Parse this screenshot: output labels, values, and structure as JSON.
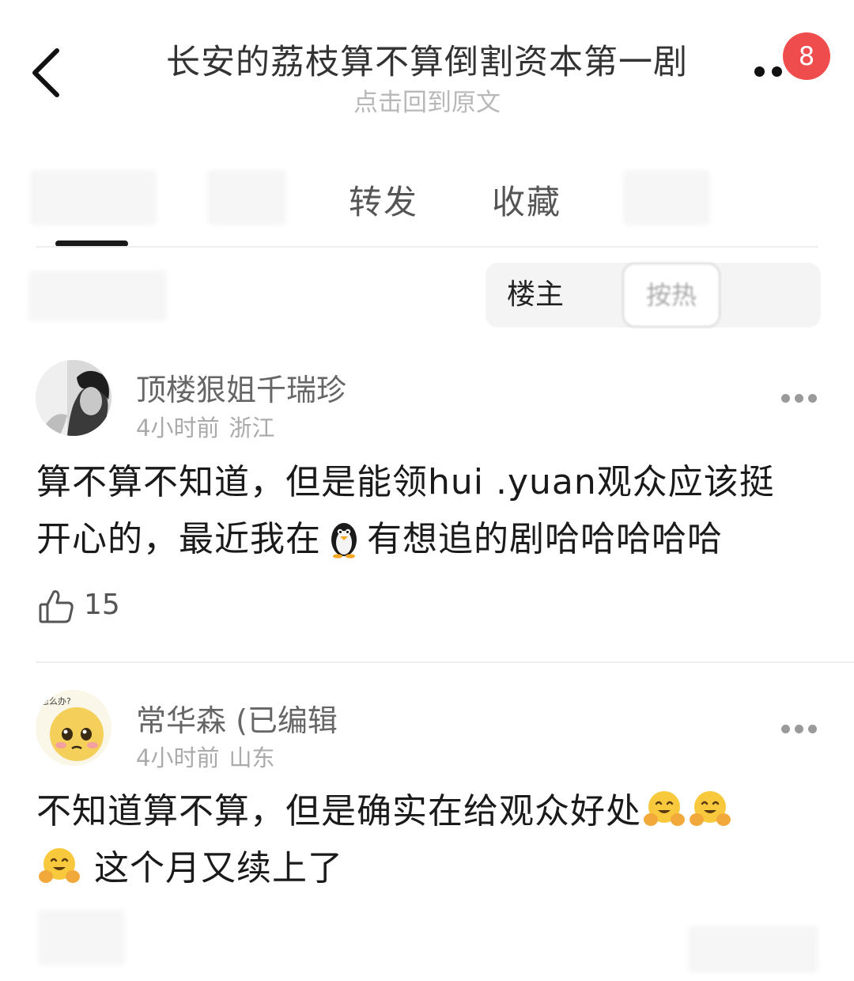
{
  "header": {
    "title": "长安的荔枝算不算倒割资本第一剧",
    "subtitle": "点击回到原文",
    "badge_count": "8"
  },
  "tabs": [
    {
      "label": "转发"
    },
    {
      "label": "收藏"
    }
  ],
  "filter": {
    "op_label": "楼主",
    "sort_label": "按热"
  },
  "comments": [
    {
      "username": "顶楼狠姐千瑞珍",
      "time": "4小时前",
      "location": "浙江",
      "text_line1": "算不算不知道，但是能领hui .yuan观众应该挺",
      "text_line2_before": "开心的，最近我在",
      "text_line2_emoji": "penguin-emoji",
      "text_line2_after": "有想追的剧哈哈哈哈哈",
      "likes": "15"
    },
    {
      "username": "常华森 (已编辑",
      "avatar_text": "怎么办?",
      "time": "4小时前",
      "location": "山东",
      "text_line1": "不知道算不算，但是确实在给观众好处",
      "text_line2": "这个月又续上了",
      "emoji": "hugging-face-emoji"
    }
  ],
  "colors": {
    "badge": "#ef4d4d",
    "text_primary": "#1a1a1a",
    "text_secondary": "#666666",
    "text_muted": "#aaaaaa"
  }
}
